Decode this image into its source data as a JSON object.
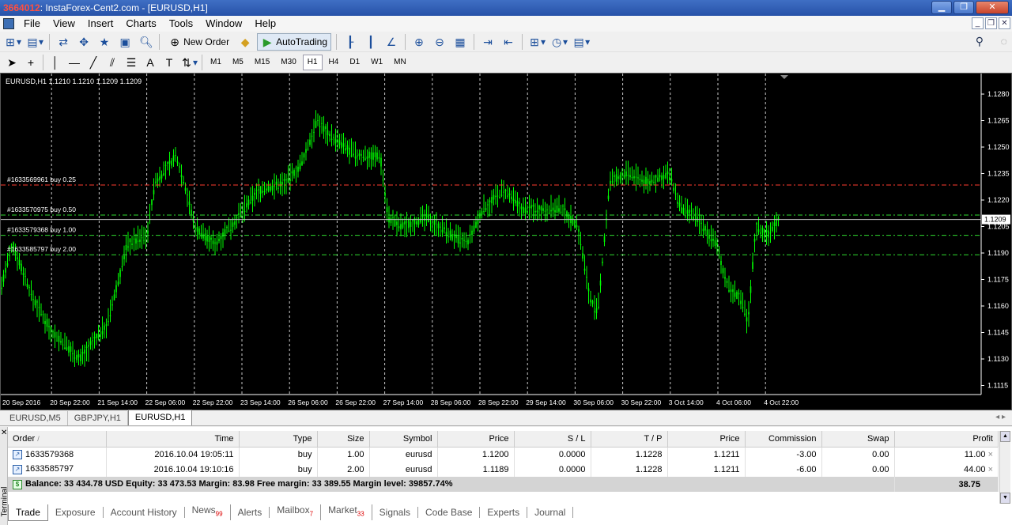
{
  "window": {
    "title_prefix": "3664012",
    "title": ": InstaForex-Cent2.com - [EURUSD,H1]"
  },
  "menu": [
    "File",
    "View",
    "Insert",
    "Charts",
    "Tools",
    "Window",
    "Help"
  ],
  "toolbar": {
    "new_order": "New Order",
    "autotrading": "AutoTrading"
  },
  "timeframes": [
    "M1",
    "M5",
    "M15",
    "M30",
    "H1",
    "H4",
    "D1",
    "W1",
    "MN"
  ],
  "active_timeframe": "H1",
  "chart": {
    "header": "EURUSD,H1  1.1210 1.1210 1.1209 1.1209",
    "current_price": "1.1209",
    "price_labels": [
      "1.1280",
      "1.1265",
      "1.1250",
      "1.1235",
      "1.1220",
      "1.1205",
      "1.1190",
      "1.1175",
      "1.1160",
      "1.1145",
      "1.1130",
      "1.1115"
    ],
    "time_labels": [
      "20 Sep 2016",
      "20 Sep 22:00",
      "21 Sep 14:00",
      "22 Sep 06:00",
      "22 Sep 22:00",
      "23 Sep 14:00",
      "26 Sep 06:00",
      "26 Sep 22:00",
      "27 Sep 14:00",
      "28 Sep 06:00",
      "28 Sep 22:00",
      "29 Sep 14:00",
      "30 Sep 06:00",
      "30 Sep 22:00",
      "3 Oct 14:00",
      "4 Oct 06:00",
      "4 Oct 22:00"
    ],
    "order_lines": [
      {
        "label": "#1633569961 buy 0.25",
        "price": 1.12285,
        "color": "#ff3b30"
      },
      {
        "label": "#1633570975 buy 0.50",
        "price": 1.12115,
        "color": "#2fdc2f"
      },
      {
        "label": "#1633579368 buy 1.00",
        "price": 1.12,
        "color": "#2fdc2f"
      },
      {
        "label": "#1633585797 buy 2.00",
        "price": 1.1189,
        "color": "#2fdc2f"
      }
    ],
    "colors": {
      "candle": "#00ff00",
      "background": "#000000",
      "grid": "#c8c8c8"
    }
  },
  "chart_tabs": [
    "EURUSD,M5",
    "GBPJPY,H1",
    "EURUSD,H1"
  ],
  "active_chart_tab": "EURUSD,H1",
  "trade": {
    "columns": [
      "Order",
      "Time",
      "Type",
      "Size",
      "Symbol",
      "Price",
      "S / L",
      "T / P",
      "Price",
      "Commission",
      "Swap",
      "Profit"
    ],
    "sort_mark": "/",
    "rows": [
      [
        "1633579368",
        "2016.10.04 19:05:11",
        "buy",
        "1.00",
        "eurusd",
        "1.1200",
        "0.0000",
        "1.1228",
        "1.1211",
        "-3.00",
        "0.00",
        "11.00"
      ],
      [
        "1633585797",
        "2016.10.04 19:10:16",
        "buy",
        "2.00",
        "eurusd",
        "1.1189",
        "0.0000",
        "1.1228",
        "1.1211",
        "-6.00",
        "0.00",
        "44.00"
      ]
    ],
    "balance_line": "Balance: 33 434.78 USD  Equity: 33 473.53  Margin: 83.98  Free margin: 33 389.55  Margin level: 39857.74%",
    "total_profit": "38.75"
  },
  "terminal_label": "Terminal",
  "terminal_tabs": [
    {
      "label": "Trade",
      "badge": ""
    },
    {
      "label": "Exposure",
      "badge": ""
    },
    {
      "label": "Account History",
      "badge": ""
    },
    {
      "label": "News",
      "badge": "99"
    },
    {
      "label": "Alerts",
      "badge": ""
    },
    {
      "label": "Mailbox",
      "badge": "7"
    },
    {
      "label": "Market",
      "badge": "33"
    },
    {
      "label": "Signals",
      "badge": ""
    },
    {
      "label": "Code Base",
      "badge": ""
    },
    {
      "label": "Experts",
      "badge": ""
    },
    {
      "label": "Journal",
      "badge": ""
    }
  ]
}
